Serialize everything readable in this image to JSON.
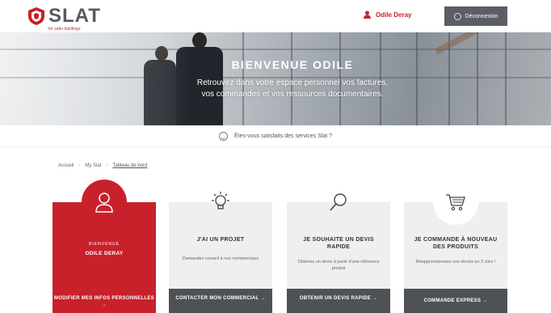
{
  "header": {
    "logo_text": "SLAT",
    "logo_tagline": "for safer buildings",
    "user_name": "Odile Deray",
    "logout_label": "Déconnexion"
  },
  "hero": {
    "title": "BIENVENUE ODILE",
    "subtitle_line1": "Retrouvez dans votre espace personnel vos factures,",
    "subtitle_line2": "vos commandes et vos ressources documentaires."
  },
  "satisfaction": {
    "text": "Êtes-vous satisfaits des services Slat ?"
  },
  "breadcrumb": {
    "items": [
      "Accueil",
      "My Slat",
      "Tableau de bord"
    ],
    "separator": "›"
  },
  "cards": [
    {
      "icon": "user-icon",
      "sub": "BIENVENUE",
      "title": "ODILE DERAY",
      "desc": "",
      "action": "MODIFIER MES INFOS PERSONNELLES →"
    },
    {
      "icon": "lightbulb-icon",
      "sub": "",
      "title": "J'AI UN PROJET",
      "desc": "Demandez conseil à nos commerciaux",
      "action": "CONTACTER MON COMMERCIAL →"
    },
    {
      "icon": "search-icon",
      "sub": "",
      "title": "JE SOUHAITE UN DEVIS RAPIDE",
      "desc": "Obtenez un devis à partir d'une référence produit",
      "action": "OBTENIR UN DEVIS RAPIDE →"
    },
    {
      "icon": "cart-icon",
      "sub": "",
      "title": "JE COMMANDE À NOUVEAU DES PRODUITS",
      "desc": "Réapprovisionnez vos stocks en 3 clics !",
      "action": "COMMANDE EXPRESS →"
    }
  ],
  "colors": {
    "brand_red": "#c8212c",
    "dark_gray": "#4e5257",
    "card_gray": "#efefef"
  }
}
